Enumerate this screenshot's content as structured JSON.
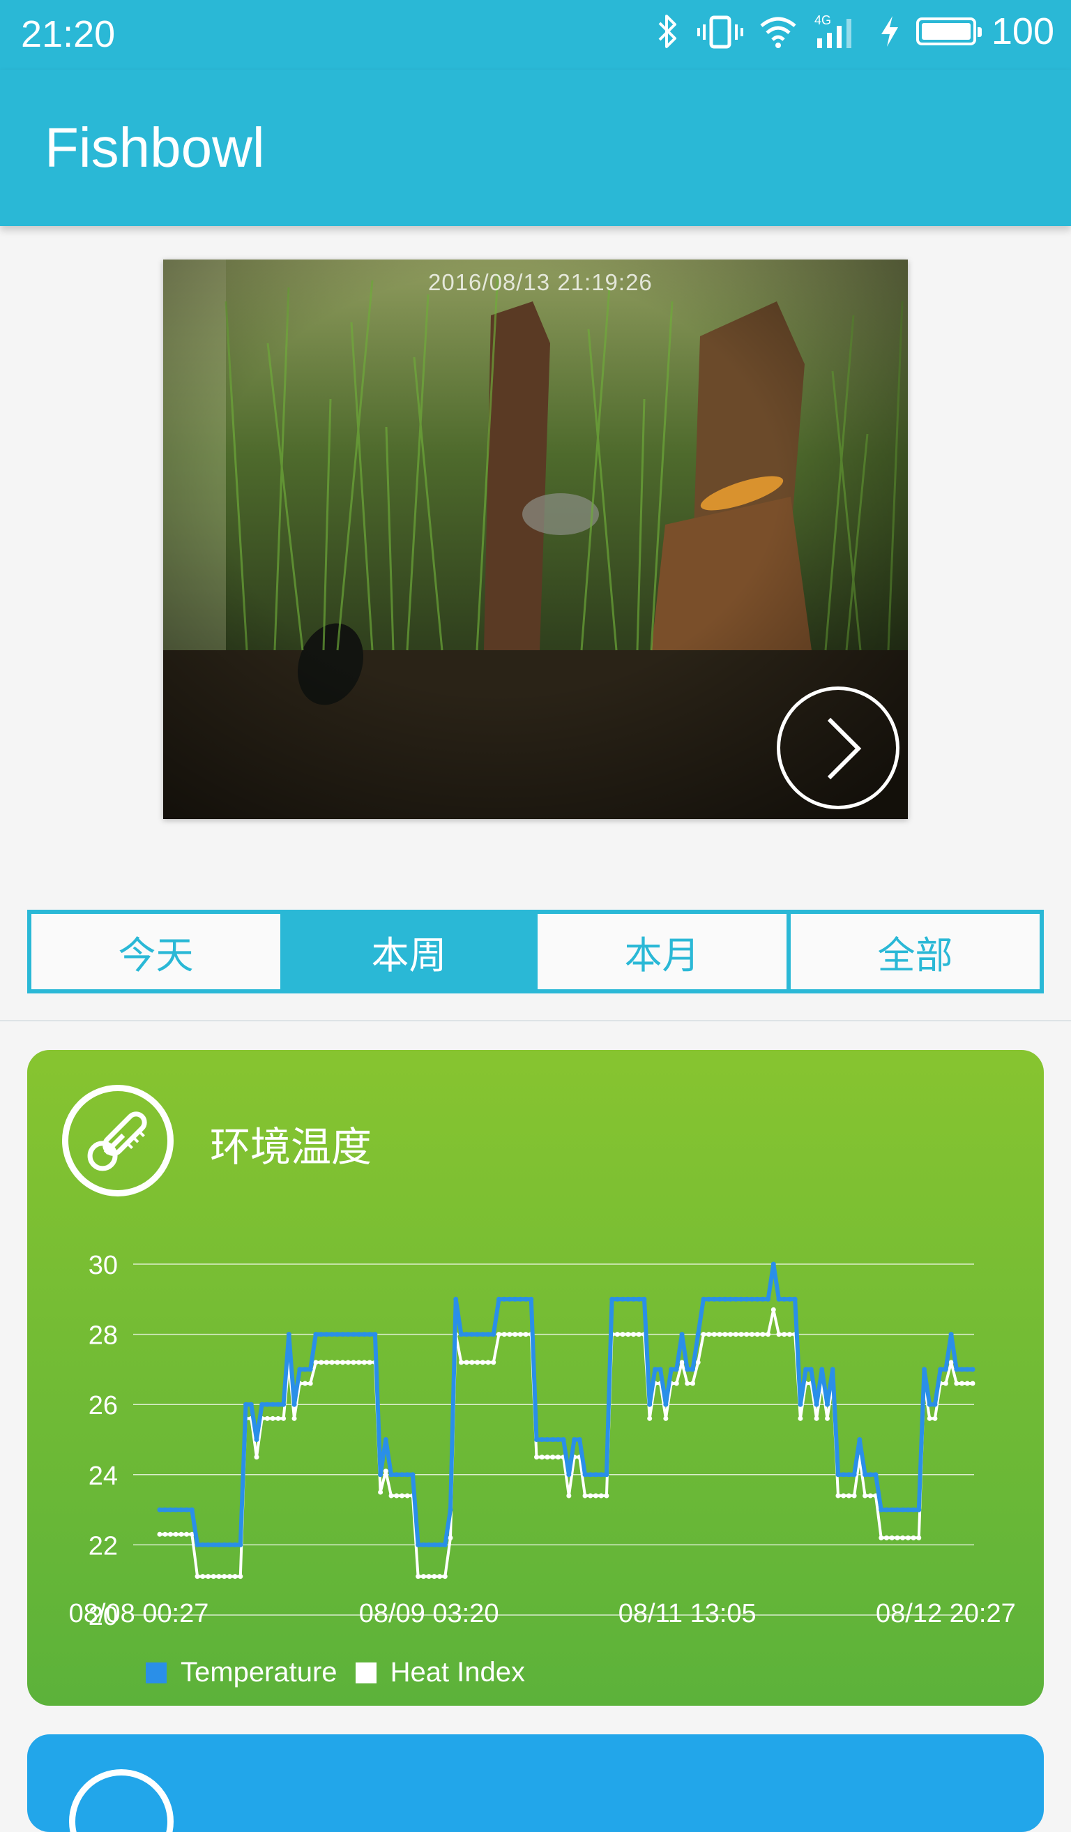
{
  "status_bar": {
    "time": "21:20",
    "battery": "100",
    "network": "4G"
  },
  "app_bar": {
    "title": "Fishbowl"
  },
  "camera": {
    "timestamp": "2016/08/13 21:19:26"
  },
  "tabs": [
    {
      "label": "今天",
      "active": false
    },
    {
      "label": "本周",
      "active": true
    },
    {
      "label": "本月",
      "active": false
    },
    {
      "label": "全部",
      "active": false
    }
  ],
  "temperature_card": {
    "title": "环境温度",
    "icon": "thermometer-icon",
    "color": "#74bb35"
  },
  "chart_data": {
    "type": "line",
    "ylim": [
      20,
      30
    ],
    "y_ticks": [
      "20",
      "22",
      "24",
      "26",
      "28",
      "30"
    ],
    "x_tick_labels": [
      "08/08 00:27",
      "08/09 03:20",
      "08/11 13:05",
      "08/12 20:27"
    ],
    "grid": true,
    "legend_position": "bottom",
    "series": [
      {
        "name": "Temperature",
        "color": "#2a8fe8",
        "values": [
          23,
          23,
          23,
          23,
          23,
          23,
          23,
          22,
          22,
          22,
          22,
          22,
          22,
          22,
          22,
          22,
          26,
          26,
          25,
          26,
          26,
          26,
          26,
          26,
          28,
          26,
          27,
          27,
          27,
          28,
          28,
          28,
          28,
          28,
          28,
          28,
          28,
          28,
          28,
          28,
          28,
          24,
          25,
          24,
          24,
          24,
          24,
          24,
          22,
          22,
          22,
          22,
          22,
          22,
          23,
          29,
          28,
          28,
          28,
          28,
          28,
          28,
          28,
          29,
          29,
          29,
          29,
          29,
          29,
          29,
          25,
          25,
          25,
          25,
          25,
          25,
          24,
          25,
          25,
          24,
          24,
          24,
          24,
          24,
          29,
          29,
          29,
          29,
          29,
          29,
          29,
          26,
          27,
          27,
          26,
          27,
          27,
          28,
          27,
          27,
          28,
          29,
          29,
          29,
          29,
          29,
          29,
          29,
          29,
          29,
          29,
          29,
          29,
          29,
          30,
          29,
          29,
          29,
          29,
          26,
          27,
          27,
          26,
          27,
          26,
          27,
          24,
          24,
          24,
          24,
          25,
          24,
          24,
          24,
          23,
          23,
          23,
          23,
          23,
          23,
          23,
          23,
          27,
          26,
          26,
          27,
          27,
          28,
          27,
          27,
          27,
          27
        ]
      },
      {
        "name": "Heat Index",
        "color": "#ffffff",
        "values": [
          22.3,
          22.3,
          22.3,
          22.3,
          22.3,
          22.3,
          22.3,
          21.1,
          21.1,
          21.1,
          21.1,
          21.1,
          21.1,
          21.1,
          21.1,
          21.1,
          25.6,
          25.6,
          24.5,
          25.6,
          25.6,
          25.6,
          25.6,
          25.6,
          27.2,
          25.6,
          26.6,
          26.6,
          26.6,
          27.2,
          27.2,
          27.2,
          27.2,
          27.2,
          27.2,
          27.2,
          27.2,
          27.2,
          27.2,
          27.2,
          27.2,
          23.5,
          24.1,
          23.4,
          23.4,
          23.4,
          23.4,
          23.4,
          21.1,
          21.1,
          21.1,
          21.1,
          21.1,
          21.1,
          22.2,
          28.0,
          27.2,
          27.2,
          27.2,
          27.2,
          27.2,
          27.2,
          27.2,
          28.0,
          28.0,
          28.0,
          28.0,
          28.0,
          28.0,
          28.0,
          24.5,
          24.5,
          24.5,
          24.5,
          24.5,
          24.5,
          23.4,
          24.5,
          24.5,
          23.4,
          23.4,
          23.4,
          23.4,
          23.4,
          28.0,
          28.0,
          28.0,
          28.0,
          28.0,
          28.0,
          28.0,
          25.6,
          26.6,
          26.6,
          25.6,
          26.6,
          26.6,
          27.2,
          26.6,
          26.6,
          27.2,
          28.0,
          28.0,
          28.0,
          28.0,
          28.0,
          28.0,
          28.0,
          28.0,
          28.0,
          28.0,
          28.0,
          28.0,
          28.0,
          28.7,
          28.0,
          28.0,
          28.0,
          28.0,
          25.6,
          26.6,
          26.6,
          25.6,
          26.6,
          25.6,
          26.6,
          23.4,
          23.4,
          23.4,
          23.4,
          24.5,
          23.4,
          23.4,
          23.4,
          22.2,
          22.2,
          22.2,
          22.2,
          22.2,
          22.2,
          22.2,
          22.2,
          26.6,
          25.6,
          25.6,
          26.6,
          26.6,
          27.2,
          26.6,
          26.6,
          26.6,
          26.6
        ]
      }
    ]
  }
}
